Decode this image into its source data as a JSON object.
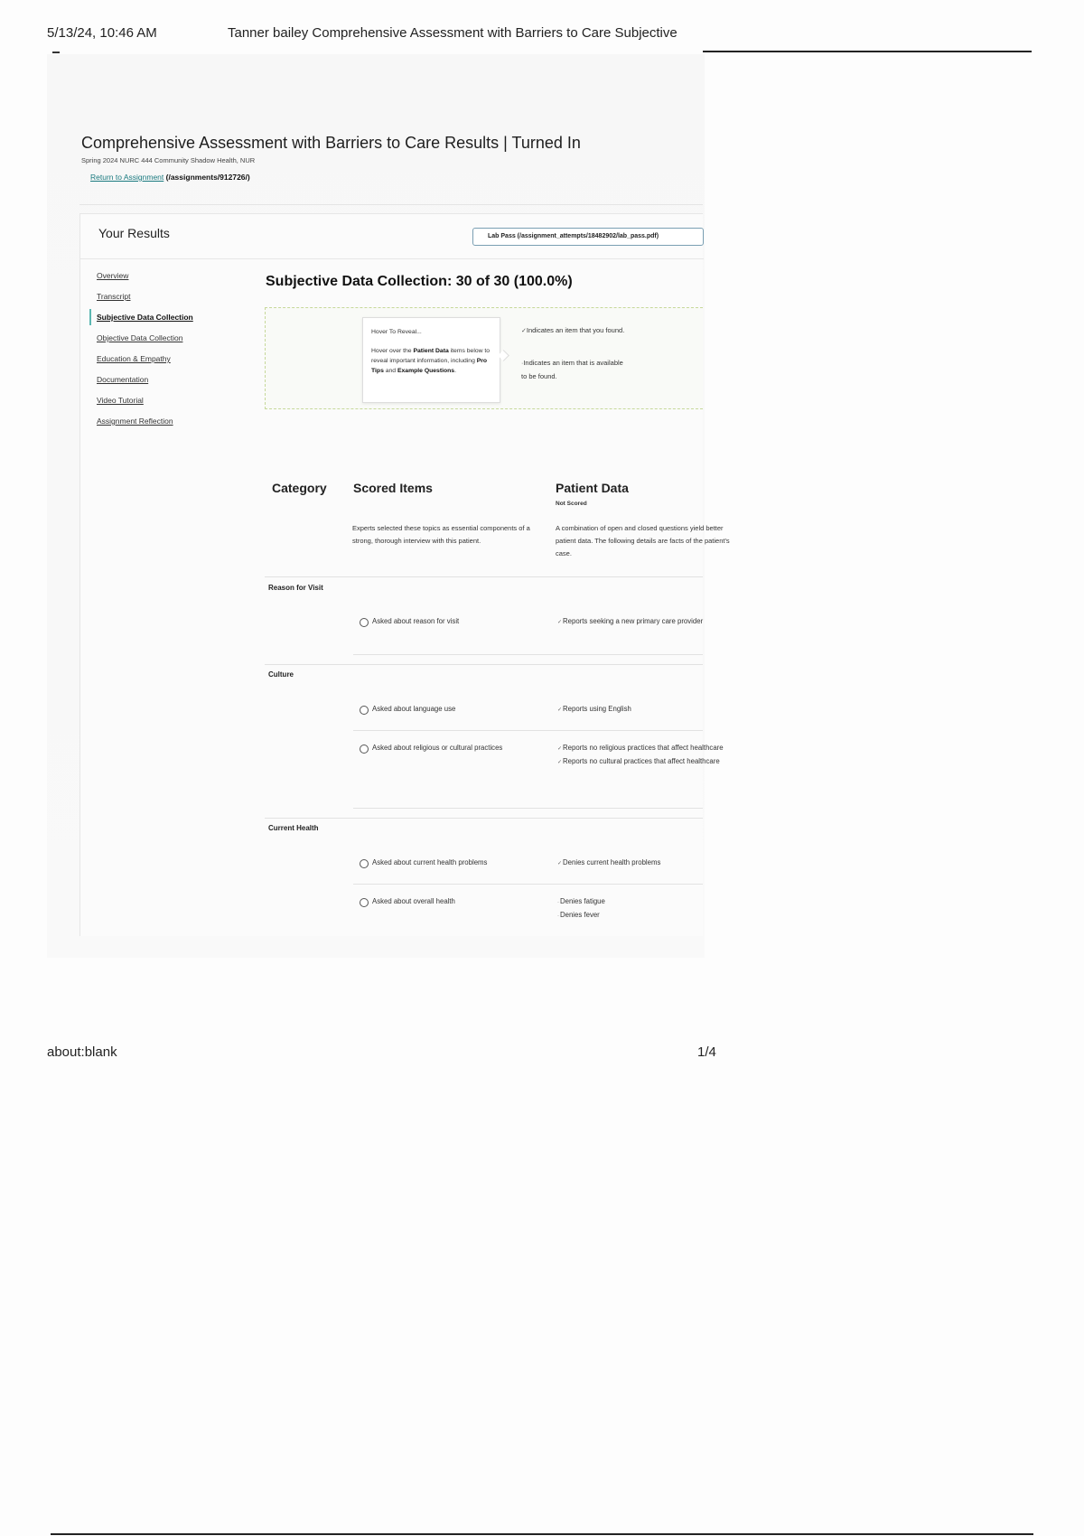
{
  "print_header": {
    "date": "5/13/24, 10:46 AM",
    "title": "Tanner bailey Comprehensive Assessment with Barriers to Care Subjective"
  },
  "print_footer": {
    "url": "about:blank",
    "page": "1/4"
  },
  "page": {
    "title": "Comprehensive Assessment with Barriers to Care Results | Turned In",
    "subtitle": "Spring 2024 NURC 444 Community Shadow Health, NUR",
    "return_link": "Return to Assignment",
    "return_path": "(/assignments/912726/)"
  },
  "results": {
    "heading": "Your Results",
    "lab_pass": "Lab Pass (/assignment_attempts/18482902/lab_pass.pdf)"
  },
  "nav": {
    "items": [
      {
        "label": "Overview",
        "active": false
      },
      {
        "label": "Transcript",
        "active": false
      },
      {
        "label": "Subjective Data Collection",
        "active": true
      },
      {
        "label": "Objective Data Collection",
        "active": false
      },
      {
        "label": "Education & Empathy",
        "active": false
      },
      {
        "label": "Documentation",
        "active": false
      },
      {
        "label": "Video Tutorial",
        "active": false
      },
      {
        "label": "Assignment Reflection",
        "active": false
      }
    ]
  },
  "section": {
    "title": "Subjective Data Collection: 30 of 30 (100.0%)"
  },
  "legend": {
    "tooltip_head": "Hover To Reveal...",
    "tooltip_pre": "Hover over the ",
    "tooltip_patient_data": "Patient Data",
    "tooltip_mid": " items below to reveal important information, including ",
    "tooltip_pro_tips": "Pro Tips",
    "tooltip_and": " and ",
    "tooltip_example": "Example Questions",
    "tooltip_end": ".",
    "found_text": "Indicates an item that you found.",
    "available_text": "Indicates an item that is available to be found."
  },
  "table": {
    "headers": {
      "category": "Category",
      "scored": "Scored Items",
      "patient": "Patient Data"
    },
    "not_scored": "Not Scored",
    "scored_desc": "Experts selected these topics as essential components of a strong, thorough interview with this patient.",
    "patient_desc": "A combination of open and closed questions yield better patient data. The following details are facts of the patient's case.",
    "categories": [
      {
        "name": "Reason for Visit",
        "rows": [
          {
            "scored": "Asked about reason for visit",
            "patient": [
              "Reports seeking a new primary care provider"
            ]
          }
        ]
      },
      {
        "name": "Culture",
        "rows": [
          {
            "scored": "Asked about language use",
            "patient": [
              "Reports using English"
            ]
          },
          {
            "scored": "Asked about religious or cultural practices",
            "patient": [
              "Reports no religious practices that affect healthcare",
              "Reports no cultural practices that affect healthcare"
            ]
          }
        ]
      },
      {
        "name": "Current Health",
        "rows": [
          {
            "scored": "Asked about current health problems",
            "patient": [
              "Denies current health problems"
            ]
          },
          {
            "scored": "Asked about overall health",
            "patient": [
              "Denies fatigue",
              "Denies fever"
            ]
          }
        ]
      }
    ]
  }
}
